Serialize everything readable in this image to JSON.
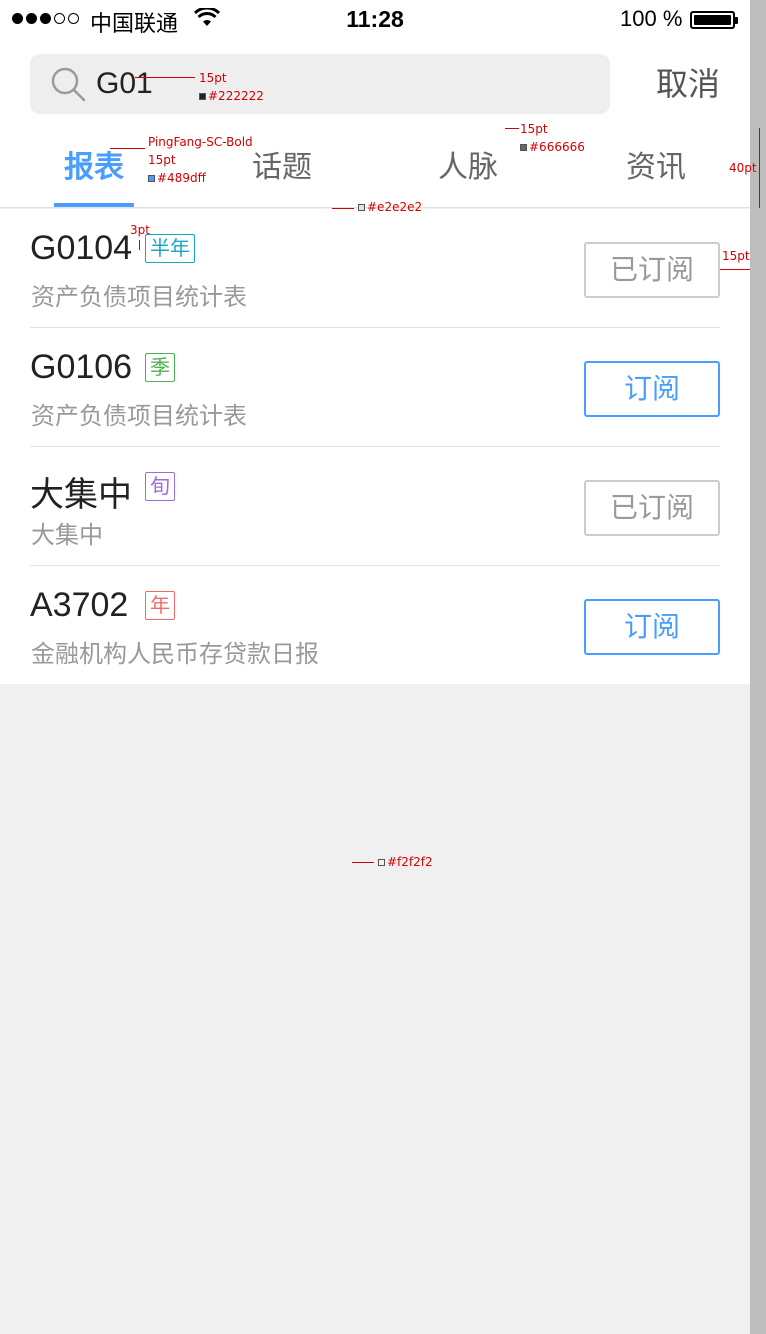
{
  "status_bar": {
    "carrier": "中国联通",
    "time": "11:28",
    "battery": "100 %"
  },
  "search": {
    "value": "G01",
    "cancel_label": "取消"
  },
  "tabs": [
    {
      "label": "报表",
      "active": true
    },
    {
      "label": "话题",
      "active": false
    },
    {
      "label": "人脉",
      "active": false
    },
    {
      "label": "资讯",
      "active": false
    }
  ],
  "items": [
    {
      "code": "G0104",
      "tag": "半年",
      "tag_color": "#1aa6c2",
      "name": "资产负债项目统计表",
      "button": "已订阅",
      "subscribed": true
    },
    {
      "code": "G0106",
      "tag": "季",
      "tag_color": "#4caf50",
      "name": "资产负债项目统计表",
      "button": "订阅",
      "subscribed": false
    },
    {
      "code": "大集中",
      "tag": "旬",
      "tag_color": "#9b6ce0",
      "name": "大集中",
      "button": "已订阅",
      "subscribed": true
    },
    {
      "code": "A3702",
      "tag": "年",
      "tag_color": "#f06a6a",
      "name": "金融机构人民币存贷款日报",
      "button": "订阅",
      "subscribed": false
    }
  ],
  "colors": {
    "accent": "#489dff",
    "text_primary": "#222222",
    "text_secondary": "#666666",
    "divider": "#e2e2e2",
    "background": "#f2f2f2"
  },
  "annotations": {
    "search_size": "15pt",
    "search_color": "#222222",
    "tab_font": "PingFang-SC-Bold",
    "tab_size": "15pt",
    "tab_color": "#489dff",
    "tab_inactive_size": "15pt",
    "tab_inactive_color": "#666666",
    "tabbar_height": "40pt",
    "divider_color": "#e2e2e2",
    "tag_gap": "3pt",
    "right_margin": "15pt",
    "bg_color": "#f2f2f2"
  }
}
